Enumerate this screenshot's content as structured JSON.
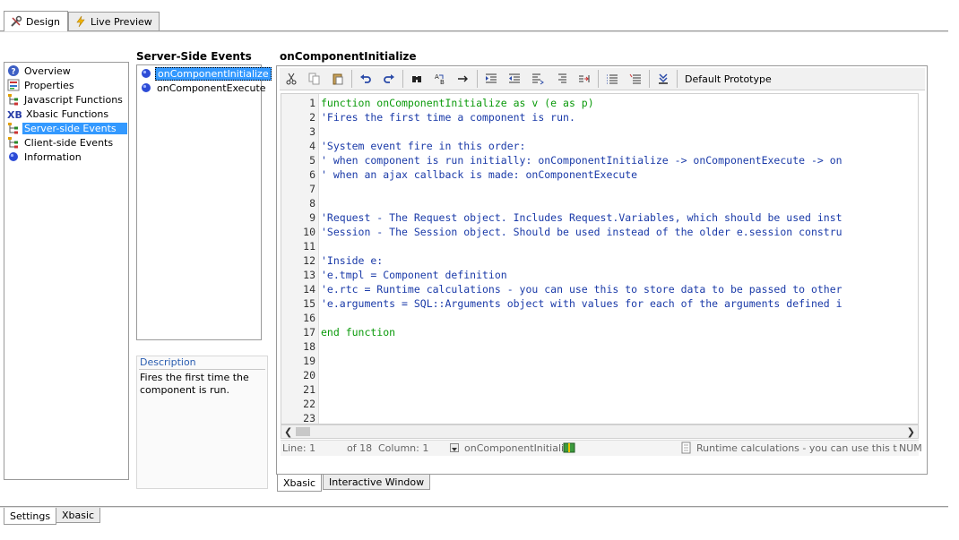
{
  "top_tabs": [
    {
      "label": "Design",
      "icon": "tools-icon",
      "active": true
    },
    {
      "label": "Live Preview",
      "icon": "lightning-icon",
      "active": false
    }
  ],
  "nav": {
    "items": [
      {
        "label": "Overview",
        "icon": "help-icon",
        "selected": false
      },
      {
        "label": "Properties",
        "icon": "properties-icon",
        "selected": false
      },
      {
        "label": "Javascript Functions",
        "icon": "tree-icon",
        "selected": false
      },
      {
        "label": "Xbasic Functions",
        "icon": "xb-icon",
        "selected": false
      },
      {
        "label": "Server-side Events",
        "icon": "tree-icon",
        "selected": true
      },
      {
        "label": "Client-side Events",
        "icon": "tree-icon",
        "selected": false
      },
      {
        "label": "Information",
        "icon": "blue-dot-icon",
        "selected": false
      }
    ]
  },
  "events": {
    "title": "Server-Side Events",
    "items": [
      {
        "label": "onComponentInitialize",
        "selected": true
      },
      {
        "label": "onComponentExecute",
        "selected": false
      }
    ]
  },
  "description": {
    "heading": "Description",
    "text": "Fires the first time the component is run."
  },
  "editor": {
    "title": "onComponentInitialize",
    "prototype_label": "Default Prototype",
    "lines": [
      {
        "n": "1",
        "text": "function onComponentInitialize as v (e as p)",
        "kind": "kw"
      },
      {
        "n": "2",
        "text": "'Fires the first time a component is run.",
        "kind": "c"
      },
      {
        "n": "3",
        "text": "",
        "kind": "c"
      },
      {
        "n": "4",
        "text": "'System event fire in this order:",
        "kind": "c"
      },
      {
        "n": "5",
        "text": "' when component is run initially: onComponentInitialize -> onComponentExecute -> on",
        "kind": "c"
      },
      {
        "n": "6",
        "text": "' when an ajax callback is made: onComponentExecute",
        "kind": "c"
      },
      {
        "n": "7",
        "text": "",
        "kind": "c"
      },
      {
        "n": "8",
        "text": "",
        "kind": "c"
      },
      {
        "n": "9",
        "text": "'Request - The Request object. Includes Request.Variables, which should be used inst",
        "kind": "c"
      },
      {
        "n": "10",
        "text": "'Session - The Session object. Should be used instead of the older e.session constru",
        "kind": "c"
      },
      {
        "n": "11",
        "text": "",
        "kind": "c"
      },
      {
        "n": "12",
        "text": "'Inside e:",
        "kind": "c"
      },
      {
        "n": "13",
        "text": "'e.tmpl = Component definition",
        "kind": "c"
      },
      {
        "n": "14",
        "text": "'e.rtc = Runtime calculations - you can use this to store data to be passed to other",
        "kind": "c"
      },
      {
        "n": "15",
        "text": "'e.arguments = SQL::Arguments object with values for each of the arguments defined i",
        "kind": "c"
      },
      {
        "n": "16",
        "text": "",
        "kind": "c"
      },
      {
        "n": "17",
        "text": "end function",
        "kind": "kw"
      },
      {
        "n": "18",
        "text": "",
        "kind": "c"
      },
      {
        "n": "19",
        "text": "",
        "kind": "c"
      },
      {
        "n": "20",
        "text": "",
        "kind": "c"
      },
      {
        "n": "21",
        "text": "",
        "kind": "c"
      },
      {
        "n": "22",
        "text": "",
        "kind": "c"
      },
      {
        "n": "23",
        "text": "",
        "kind": "c"
      }
    ],
    "status": {
      "line": "Line: 1",
      "of": "of 18",
      "column": "Column: 1",
      "function": "onComponentInitialize",
      "hint": "Runtime calculations - you can use this t",
      "num": "NUM"
    },
    "tabs": [
      {
        "label": "Xbasic",
        "active": true
      },
      {
        "label": "Interactive Window",
        "active": false
      }
    ]
  },
  "bottom_tabs": [
    {
      "label": "Settings",
      "active": true
    },
    {
      "label": "Xbasic",
      "active": false
    }
  ],
  "colors": {
    "selection": "#3399ff",
    "code_text": "#1a3aa8",
    "keyword": "#0a9a0a",
    "desc_heading": "#2a5db0"
  }
}
